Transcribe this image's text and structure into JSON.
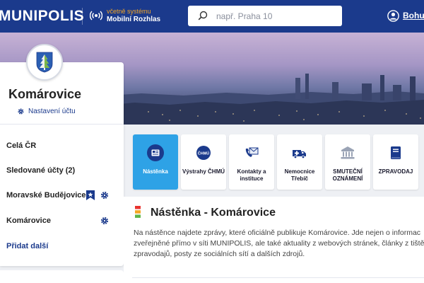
{
  "header": {
    "logo": "MUNIPOLIS",
    "radio_sub": "včetně systému",
    "radio_main": "Mobilní Rozhlas",
    "search_placeholder": "např. Praha 10",
    "user_name": "Bohum"
  },
  "sidebar": {
    "title": "Komárovice",
    "settings_label": "Nastavení účtu",
    "items": [
      {
        "label": "Celá ČR"
      },
      {
        "label": "Sledované účty (2)"
      },
      {
        "label": "Moravské Budějovice"
      },
      {
        "label": "Komárovice"
      }
    ],
    "add_label": "Přidat další"
  },
  "tiles": [
    {
      "label": "Nástěnka",
      "icon": "board-icon",
      "active": true
    },
    {
      "label": "Výstrahy ČHMÚ",
      "icon": "chmu-icon",
      "active": false
    },
    {
      "label": "Kontakty a instituce",
      "icon": "phone-mail-icon",
      "active": false
    },
    {
      "label": "Nemocnice Třebíč",
      "icon": "ambulance-icon",
      "active": false
    },
    {
      "label": "SMUTEČNÍ OZNÁMENÍ",
      "icon": "building-icon",
      "active": false
    },
    {
      "label": "ZPRAVODAJ",
      "icon": "book-icon",
      "active": false
    }
  ],
  "main": {
    "heading": "Nástěnka - Komárovice",
    "description_lines": [
      "Na nástěnce najdete zprávy, které oficiálně publikuje Komárovice. Jde nejen o informac",
      "zveřejněné přímo v síti MUNIPOLIS, ale také aktuality z webových stránek, články z tiště",
      "zpravodajů, posty ze sociálních sítí a dalších zdrojů."
    ]
  },
  "colors": {
    "header_bg": "#1b3a8c",
    "accent": "#2ea2e6",
    "radio_accent": "#f5a623"
  }
}
